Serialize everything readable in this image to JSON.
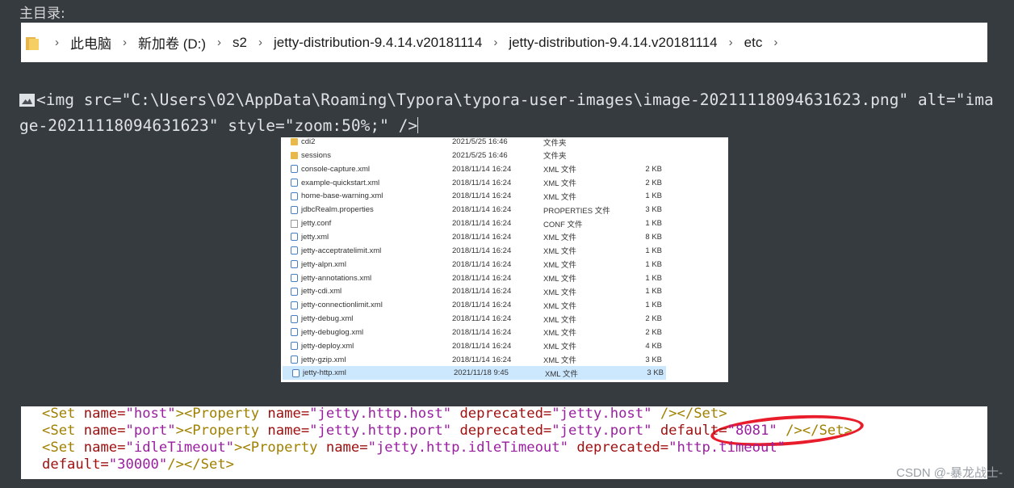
{
  "heading": "主目录:",
  "breadcrumb": [
    "此电脑",
    "新加卷 (D:)",
    "s2",
    "jetty-distribution-9.4.14.v20181114",
    "jetty-distribution-9.4.14.v20181114",
    "etc"
  ],
  "raw_line": "<img src=\"C:\\Users\\02\\AppData\\Roaming\\Typora\\typora-user-images\\image-20211118094631623.png\" alt=\"image-20211118094631623\" style=\"zoom:50%;\" />",
  "files": [
    {
      "name": "cdi2",
      "date": "2021/5/25 16:46",
      "type": "文件夹",
      "size": "",
      "icon": "folder-icon"
    },
    {
      "name": "sessions",
      "date": "2021/5/25 16:46",
      "type": "文件夹",
      "size": "",
      "icon": "folder-icon"
    },
    {
      "name": "console-capture.xml",
      "date": "2018/11/14 16:24",
      "type": "XML 文件",
      "size": "2 KB",
      "icon": "xml-file-icon"
    },
    {
      "name": "example-quickstart.xml",
      "date": "2018/11/14 16:24",
      "type": "XML 文件",
      "size": "2 KB",
      "icon": "xml-file-icon"
    },
    {
      "name": "home-base-warning.xml",
      "date": "2018/11/14 16:24",
      "type": "XML 文件",
      "size": "1 KB",
      "icon": "xml-file-icon"
    },
    {
      "name": "jdbcRealm.properties",
      "date": "2018/11/14 16:24",
      "type": "PROPERTIES 文件",
      "size": "3 KB",
      "icon": "xml-file-icon"
    },
    {
      "name": "jetty.conf",
      "date": "2018/11/14 16:24",
      "type": "CONF 文件",
      "size": "1 KB",
      "icon": "file-icon"
    },
    {
      "name": "jetty.xml",
      "date": "2018/11/14 16:24",
      "type": "XML 文件",
      "size": "8 KB",
      "icon": "xml-file-icon"
    },
    {
      "name": "jetty-acceptratelimit.xml",
      "date": "2018/11/14 16:24",
      "type": "XML 文件",
      "size": "1 KB",
      "icon": "xml-file-icon"
    },
    {
      "name": "jetty-alpn.xml",
      "date": "2018/11/14 16:24",
      "type": "XML 文件",
      "size": "1 KB",
      "icon": "xml-file-icon"
    },
    {
      "name": "jetty-annotations.xml",
      "date": "2018/11/14 16:24",
      "type": "XML 文件",
      "size": "1 KB",
      "icon": "xml-file-icon"
    },
    {
      "name": "jetty-cdi.xml",
      "date": "2018/11/14 16:24",
      "type": "XML 文件",
      "size": "1 KB",
      "icon": "xml-file-icon"
    },
    {
      "name": "jetty-connectionlimit.xml",
      "date": "2018/11/14 16:24",
      "type": "XML 文件",
      "size": "1 KB",
      "icon": "xml-file-icon"
    },
    {
      "name": "jetty-debug.xml",
      "date": "2018/11/14 16:24",
      "type": "XML 文件",
      "size": "2 KB",
      "icon": "xml-file-icon"
    },
    {
      "name": "jetty-debuglog.xml",
      "date": "2018/11/14 16:24",
      "type": "XML 文件",
      "size": "2 KB",
      "icon": "xml-file-icon"
    },
    {
      "name": "jetty-deploy.xml",
      "date": "2018/11/14 16:24",
      "type": "XML 文件",
      "size": "4 KB",
      "icon": "xml-file-icon"
    },
    {
      "name": "jetty-gzip.xml",
      "date": "2018/11/14 16:24",
      "type": "XML 文件",
      "size": "3 KB",
      "icon": "xml-file-icon"
    },
    {
      "name": "jetty-http.xml",
      "date": "2021/11/18 9:45",
      "type": "XML 文件",
      "size": "3 KB",
      "icon": "xml-file-icon",
      "selected": true
    }
  ],
  "code_lines": [
    [
      [
        "tag",
        "<Set "
      ],
      [
        "attr",
        "name="
      ],
      [
        "val",
        "\"host\""
      ],
      [
        "tag",
        "><Property "
      ],
      [
        "attr",
        "name="
      ],
      [
        "val",
        "\"jetty.http.host\""
      ],
      [
        "tag",
        " "
      ],
      [
        "attr",
        "deprecated="
      ],
      [
        "val",
        "\"jetty.host\""
      ],
      [
        "tag",
        " /></Set>"
      ]
    ],
    [
      [
        "tag",
        "<Set "
      ],
      [
        "attr",
        "name="
      ],
      [
        "val",
        "\"port\""
      ],
      [
        "tag",
        "><Property "
      ],
      [
        "attr",
        "name="
      ],
      [
        "val",
        "\"jetty.http.port\""
      ],
      [
        "tag",
        " "
      ],
      [
        "attr",
        "deprecated="
      ],
      [
        "val",
        "\"jetty.port\""
      ],
      [
        "tag",
        " "
      ],
      [
        "attr",
        "default="
      ],
      [
        "val",
        "\"8081\""
      ],
      [
        "tag",
        " /></Set>"
      ]
    ],
    [
      [
        "tag",
        "<Set "
      ],
      [
        "attr",
        "name="
      ],
      [
        "val",
        "\"idleTimeout\""
      ],
      [
        "tag",
        "><Property "
      ],
      [
        "attr",
        "name="
      ],
      [
        "val",
        "\"jetty.http.idleTimeout\""
      ],
      [
        "tag",
        " "
      ],
      [
        "attr",
        "deprecated="
      ],
      [
        "val",
        "\"http.timeout\""
      ]
    ],
    [
      [
        "attr",
        "default="
      ],
      [
        "val",
        "\"30000\""
      ],
      [
        "tag",
        "/></Set>"
      ]
    ]
  ],
  "watermark": "CSDN @-暴龙战士-",
  "colors": {
    "highlight_circle": "#e81c2a",
    "selected_row": "#cce8ff"
  }
}
